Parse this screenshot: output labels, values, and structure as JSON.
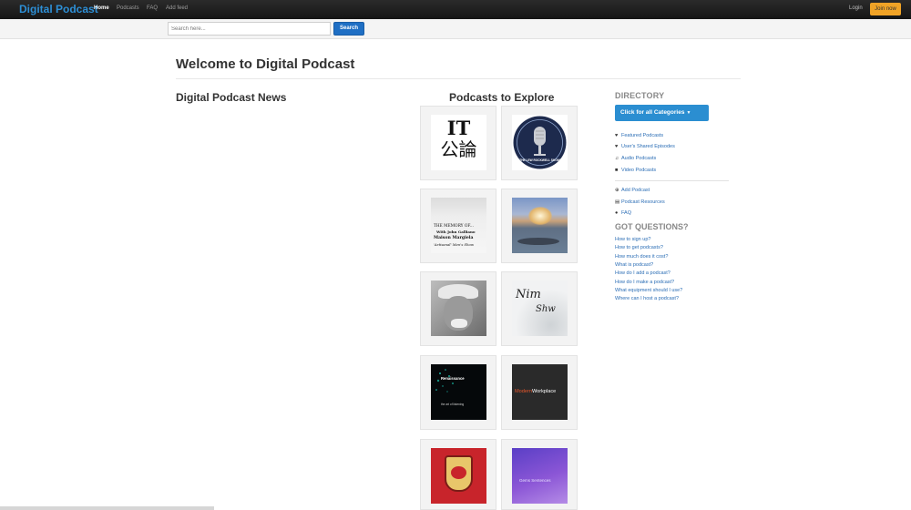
{
  "navbar": {
    "brand": "Digital Podcast",
    "links": [
      "Home",
      "Podcasts",
      "FAQ",
      "Add feed"
    ],
    "login": "Login",
    "join": "Join now"
  },
  "search": {
    "placeholder": "Search here...",
    "button": "Search"
  },
  "page_title": "Welcome to Digital Podcast",
  "news_title": "Digital Podcast News",
  "explore_title": "Podcasts to Explore",
  "tiles": [
    {
      "art_text_1": "IT",
      "art_text_2": "公論"
    },
    {
      "art_text_1": "THE LEW ROCKWELL SHOW"
    },
    {
      "art_text_1": "THE MEMORY OF...",
      "art_text_2": "With John Galliano",
      "art_text_3": "Maison Margiela",
      "art_text_4": "'Artisanal' Men's Show"
    },
    {},
    {},
    {
      "art_text_1": "Nim",
      "art_text_2": "Shw"
    },
    {
      "art_text_1": "Renaissance",
      "art_text_2": "the art of listening"
    },
    {
      "art_text_1": "Modern",
      "art_text_2": "Workplace"
    },
    {},
    {
      "art_text_1": "Gems Sentences"
    }
  ],
  "sidebar": {
    "directory_title": "DIRECTORY",
    "category_button": "Click for all Categories",
    "links_1": [
      {
        "icon": "heart-icon",
        "label": "Featured Podcasts"
      },
      {
        "icon": "heart-icon",
        "label": "User's Shared Episodes"
      },
      {
        "icon": "headphones-icon",
        "label": "Audio Podcasts"
      },
      {
        "icon": "video-icon",
        "label": "Video Podcasts"
      }
    ],
    "links_2": [
      {
        "icon": "plus-circle-icon",
        "label": "Add Podcast"
      },
      {
        "icon": "book-icon",
        "label": "Podcast Resources"
      },
      {
        "icon": "question-circle-icon",
        "label": "FAQ"
      }
    ],
    "questions_title": "GOT QUESTIONS?",
    "questions": [
      "How to sign up?",
      "How to get podcasts?",
      "How much does it cost?",
      "What is podcast?",
      "How do I add a podcast?",
      "How do I make a podcast?",
      "What equipment should I use?",
      "Where can I host a podcast?"
    ]
  },
  "colors": {
    "brand": "#2d8fd6",
    "accent_button": "#2b8ed1",
    "join_button": "#f0a326",
    "link": "#2a6db5"
  }
}
